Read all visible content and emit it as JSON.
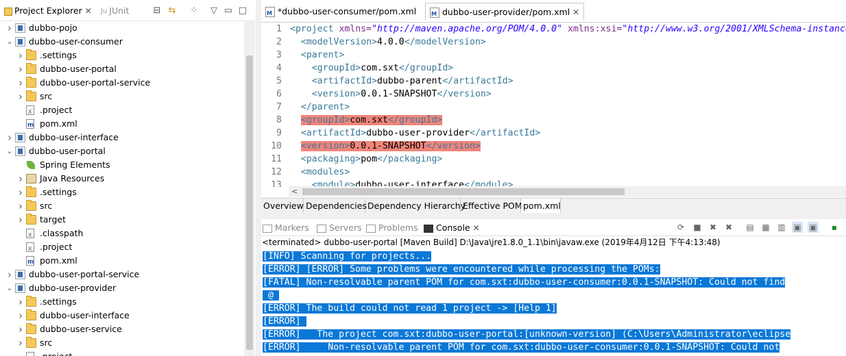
{
  "explorer": {
    "tabs": {
      "project_explorer": "Project Explorer",
      "junit": "JUnit"
    },
    "tree": [
      {
        "label": "dubbo-pojo",
        "icon": "maven-project-icon",
        "expander": ">"
      },
      {
        "label": "dubbo-user-consumer",
        "icon": "maven-project-icon",
        "expander": "v"
      },
      {
        "label": ".settings",
        "icon": "folder-icon",
        "expander": ">"
      },
      {
        "label": "dubbo-user-portal",
        "icon": "folder-icon",
        "expander": ">"
      },
      {
        "label": "dubbo-user-portal-service",
        "icon": "folder-icon",
        "expander": ">"
      },
      {
        "label": "src",
        "icon": "folder-icon",
        "expander": ">"
      },
      {
        "label": ".project",
        "icon": "xml-file-icon",
        "expander": ""
      },
      {
        "label": "pom.xml",
        "icon": "pom-file-icon",
        "expander": ""
      },
      {
        "label": "dubbo-user-interface",
        "icon": "maven-project-icon",
        "expander": ">"
      },
      {
        "label": "dubbo-user-portal",
        "icon": "spring-maven-project-icon",
        "expander": "v"
      },
      {
        "label": "Spring Elements",
        "icon": "spring-icon",
        "expander": ""
      },
      {
        "label": "Java Resources",
        "icon": "java-resources-icon",
        "expander": ">"
      },
      {
        "label": ".settings",
        "icon": "folder-icon",
        "expander": ">"
      },
      {
        "label": "src",
        "icon": "folder-icon",
        "expander": ">"
      },
      {
        "label": "target",
        "icon": "folder-icon",
        "expander": ">"
      },
      {
        "label": ".classpath",
        "icon": "xml-file-icon",
        "expander": ""
      },
      {
        "label": ".project",
        "icon": "xml-file-icon",
        "expander": ""
      },
      {
        "label": "pom.xml",
        "icon": "pom-file-icon",
        "expander": ""
      },
      {
        "label": "dubbo-user-portal-service",
        "icon": "maven-project-icon",
        "expander": ">"
      },
      {
        "label": "dubbo-user-provider",
        "icon": "maven-project-icon",
        "expander": "v"
      },
      {
        "label": ".settings",
        "icon": "folder-icon",
        "expander": ">"
      },
      {
        "label": "dubbo-user-interface",
        "icon": "folder-icon",
        "expander": ">"
      },
      {
        "label": "dubbo-user-service",
        "icon": "folder-icon",
        "expander": ">"
      },
      {
        "label": "src",
        "icon": "folder-icon",
        "expander": ">"
      },
      {
        "label": ".project",
        "icon": "xml-file-icon",
        "expander": ""
      }
    ]
  },
  "editor": {
    "tabs": [
      {
        "label": "*dubbo-user-consumer/pom.xml",
        "active": false
      },
      {
        "label": "dubbo-user-provider/pom.xml",
        "active": true
      }
    ],
    "lines": [
      {
        "n": "1"
      },
      {
        "n": "2"
      },
      {
        "n": "3"
      },
      {
        "n": "4"
      },
      {
        "n": "5"
      },
      {
        "n": "6"
      },
      {
        "n": "7"
      },
      {
        "n": "8"
      },
      {
        "n": "9"
      },
      {
        "n": "10"
      },
      {
        "n": "11"
      },
      {
        "n": "12"
      },
      {
        "n": "13"
      }
    ],
    "code": {
      "l1_tag": "<project",
      "l1_attr1": "xmlns=",
      "l1_val1": "\"http://maven.apache.org/POM/4.0.0\"",
      "l1_attr2": "xmlns:xsi=",
      "l1_val2": "\"http://www.w3.org/2001/XMLSchema-instance\"",
      "modelVersion_open": "<modelVersion>",
      "modelVersion_val": "4.0.0",
      "modelVersion_close": "</modelVersion>",
      "parent_open": "<parent>",
      "groupId_open": "<groupId>",
      "groupId_val": "com.sxt",
      "groupId_close": "</groupId>",
      "artifactId_open": "<artifactId>",
      "parent_artifact_val": "dubbo-parent",
      "artifactId_close": "</artifactId>",
      "version_open": "<version>",
      "version_val": "0.0.1-SNAPSHOT",
      "version_close": "</version>",
      "parent_close": "</parent>",
      "artifact_val": "dubbo-user-provider",
      "packaging_open": "<packaging>",
      "packaging_val": "pom",
      "packaging_close": "</packaging>",
      "modules_open": "<modules>",
      "module_open": "<module>",
      "module_val": "dubbo-user-interface",
      "module_close": "</module>"
    },
    "pom_tabs": [
      "Overview",
      "Dependencies",
      "Dependency Hierarchy",
      "Effective POM",
      "pom.xml"
    ],
    "pom_active": "pom.xml"
  },
  "console": {
    "tabs": {
      "markers": "Markers",
      "servers": "Servers",
      "problems": "Problems",
      "console": "Console"
    },
    "status": "<terminated> dubbo-user-portal [Maven Build] D:\\Java\\jre1.8.0_1.1\\bin\\javaw.exe (2019年4月12日 下午4:13:48)",
    "output": [
      "[INFO] Scanning for projects...",
      "[ERROR] [ERROR] Some problems were encountered while processing the POMs:",
      "[FATAL] Non-resolvable parent POM for com.sxt:dubbo-user-consumer:0.0.1-SNAPSHOT: Could not find",
      " @ ",
      "[ERROR] The build could not read 1 project -> [Help 1]",
      "[ERROR] ",
      "[ERROR]   The project com.sxt:dubbo-user-portal:[unknown-version] (C:\\Users\\Administrator\\eclipse",
      "[ERROR]     Non-resolvable parent POM for com.sxt:dubbo-user-consumer:0.0.1-SNAPSHOT: Could not"
    ]
  },
  "colors": {
    "selection": "#0a78d7",
    "error_highlight": "#f0857a",
    "xml_tag": "#3a7a9a",
    "xml_attr": "#7b2d8b",
    "xml_string": "#2a00ff"
  }
}
